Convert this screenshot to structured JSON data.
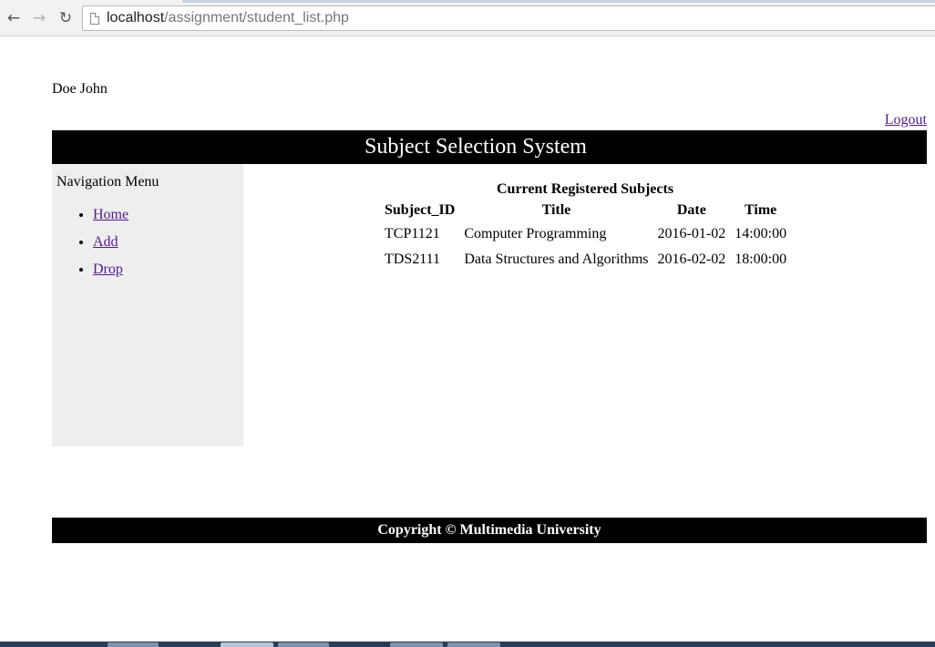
{
  "browser": {
    "url_host": "localhost",
    "url_path": "/assignment/student_list.php"
  },
  "user": {
    "name": "Doe John"
  },
  "logout_label": "Logout",
  "header": {
    "title": "Subject Selection System"
  },
  "sidebar": {
    "title": "Navigation Menu",
    "items": [
      {
        "label": "Home"
      },
      {
        "label": "Add"
      },
      {
        "label": "Drop"
      }
    ]
  },
  "table": {
    "caption": "Current Registered Subjects",
    "headers": [
      "Subject_ID",
      "Title",
      "Date",
      "Time"
    ],
    "rows": [
      [
        "TCP1121",
        "Computer Programming",
        "2016-01-02",
        "14:00:00"
      ],
      [
        "TDS2111",
        "Data Structures and Algorithms",
        "2016-02-02",
        "18:00:00"
      ]
    ]
  },
  "footer": {
    "text": "Copyright © Multimedia University"
  },
  "icons": {
    "back": "back-arrow-icon",
    "forward": "forward-arrow-icon",
    "reload": "reload-icon",
    "page": "page-icon"
  },
  "colors": {
    "header_bg": "#000000",
    "sidebar_bg": "#eeeeee",
    "visited_link": "#551a8b"
  }
}
